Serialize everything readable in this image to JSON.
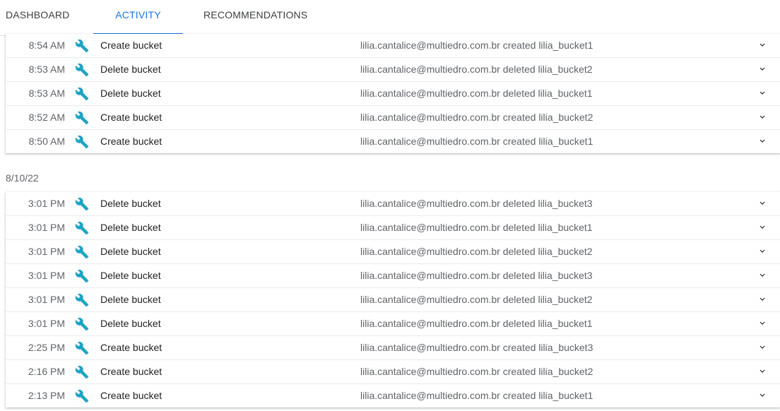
{
  "tabs": [
    {
      "label": "DASHBOARD",
      "active": false
    },
    {
      "label": "ACTIVITY",
      "active": true
    },
    {
      "label": "RECOMMENDATIONS",
      "active": false
    }
  ],
  "colors": {
    "accent": "#1a73e8",
    "wrench_icon": "#1ba3c6"
  },
  "icons": {
    "row_action": "wrench-icon",
    "row_expand": "chevron-down-icon"
  },
  "groups": [
    {
      "date": "",
      "rows": [
        {
          "time": "8:54 AM",
          "action": "Create bucket",
          "description": "lilia.cantalice@multiedro.com.br created lilia_bucket1"
        },
        {
          "time": "8:53 AM",
          "action": "Delete bucket",
          "description": "lilia.cantalice@multiedro.com.br deleted lilia_bucket2"
        },
        {
          "time": "8:53 AM",
          "action": "Delete bucket",
          "description": "lilia.cantalice@multiedro.com.br deleted lilia_bucket1"
        },
        {
          "time": "8:52 AM",
          "action": "Create bucket",
          "description": "lilia.cantalice@multiedro.com.br created lilia_bucket2"
        },
        {
          "time": "8:50 AM",
          "action": "Create bucket",
          "description": "lilia.cantalice@multiedro.com.br created lilia_bucket1"
        }
      ]
    },
    {
      "date": "8/10/22",
      "rows": [
        {
          "time": "3:01 PM",
          "action": "Delete bucket",
          "description": "lilia.cantalice@multiedro.com.br deleted lilia_bucket3"
        },
        {
          "time": "3:01 PM",
          "action": "Delete bucket",
          "description": "lilia.cantalice@multiedro.com.br deleted lilia_bucket1"
        },
        {
          "time": "3:01 PM",
          "action": "Delete bucket",
          "description": "lilia.cantalice@multiedro.com.br deleted lilia_bucket2"
        },
        {
          "time": "3:01 PM",
          "action": "Delete bucket",
          "description": "lilia.cantalice@multiedro.com.br deleted lilia_bucket3"
        },
        {
          "time": "3:01 PM",
          "action": "Delete bucket",
          "description": "lilia.cantalice@multiedro.com.br deleted lilia_bucket2"
        },
        {
          "time": "3:01 PM",
          "action": "Delete bucket",
          "description": "lilia.cantalice@multiedro.com.br deleted lilia_bucket1"
        },
        {
          "time": "2:25 PM",
          "action": "Create bucket",
          "description": "lilia.cantalice@multiedro.com.br created lilia_bucket3"
        },
        {
          "time": "2:16 PM",
          "action": "Create bucket",
          "description": "lilia.cantalice@multiedro.com.br created lilia_bucket2"
        },
        {
          "time": "2:13 PM",
          "action": "Create bucket",
          "description": "lilia.cantalice@multiedro.com.br created lilia_bucket1"
        }
      ]
    }
  ]
}
